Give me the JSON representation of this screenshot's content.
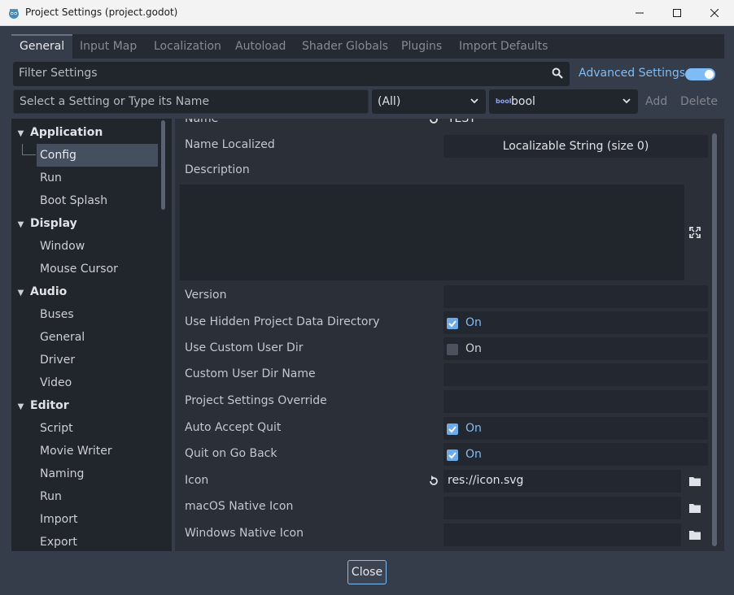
{
  "window": {
    "title": "Project Settings (project.godot)"
  },
  "tabs": [
    {
      "label": "General"
    },
    {
      "label": "Input Map"
    },
    {
      "label": "Localization"
    },
    {
      "label": "Autoload"
    },
    {
      "label": "Shader Globals"
    },
    {
      "label": "Plugins"
    },
    {
      "label": "Import Defaults"
    }
  ],
  "filter": {
    "placeholder": "Filter Settings",
    "advanced_label": "Advanced Settings",
    "advanced_enabled": true
  },
  "add_setting": {
    "placeholder": "Select a Setting or Type its Name",
    "scope_value": "(All)",
    "type_icon": "bool",
    "type_value": "bool",
    "add_label": "Add",
    "delete_label": "Delete"
  },
  "tree": {
    "categories": [
      {
        "label": "Application",
        "items": [
          "Config",
          "Run",
          "Boot Splash"
        ]
      },
      {
        "label": "Display",
        "items": [
          "Window",
          "Mouse Cursor"
        ]
      },
      {
        "label": "Audio",
        "items": [
          "Buses",
          "General",
          "Driver",
          "Video"
        ]
      },
      {
        "label": "Editor",
        "items": [
          "Script",
          "Movie Writer",
          "Naming",
          "Run",
          "Import",
          "Export"
        ]
      }
    ],
    "selected": "Config"
  },
  "properties": {
    "name": {
      "label": "Name",
      "value": "TEST"
    },
    "name_localized": {
      "label": "Name Localized",
      "value": "Localizable String (size 0)"
    },
    "description": {
      "label": "Description"
    },
    "version": {
      "label": "Version"
    },
    "use_hidden_dir": {
      "label": "Use Hidden Project Data Directory",
      "checked": true,
      "state": "On"
    },
    "use_custom_user_dir": {
      "label": "Use Custom User Dir",
      "checked": false,
      "state": "On"
    },
    "custom_user_dir_name": {
      "label": "Custom User Dir Name"
    },
    "project_settings_override": {
      "label": "Project Settings Override"
    },
    "auto_accept_quit": {
      "label": "Auto Accept Quit",
      "checked": true,
      "state": "On"
    },
    "quit_on_go_back": {
      "label": "Quit on Go Back",
      "checked": true,
      "state": "On"
    },
    "icon": {
      "label": "Icon",
      "value": "res://icon.svg"
    },
    "macos_native_icon": {
      "label": "macOS Native Icon"
    },
    "windows_native_icon": {
      "label": "Windows Native Icon"
    }
  },
  "footer": {
    "close_label": "Close"
  },
  "colors": {
    "accent": "#7fbcf6",
    "panel": "#21252c",
    "background": "#363d4a"
  }
}
